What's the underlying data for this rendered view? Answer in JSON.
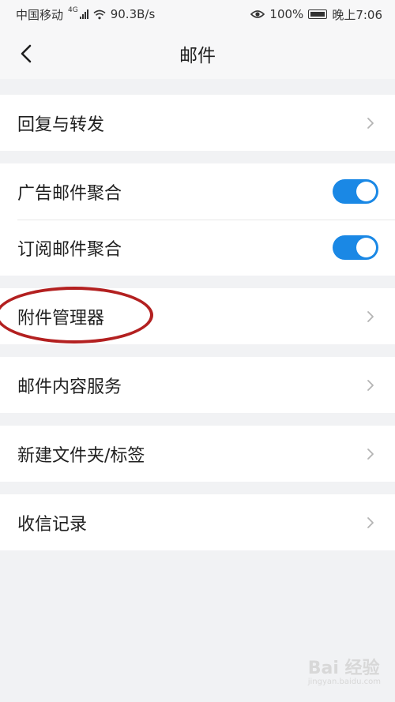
{
  "status_bar": {
    "carrier": "中国移动",
    "network": "4G",
    "speed": "90.3B/s",
    "battery": "100%",
    "time": "晚上7:06"
  },
  "header": {
    "title": "邮件",
    "back_icon": "chevron-left-icon"
  },
  "settings": {
    "reply_forward": "回复与转发",
    "ad_mail_aggregate": {
      "label": "广告邮件聚合",
      "enabled": true
    },
    "subscription_aggregate": {
      "label": "订阅邮件聚合",
      "enabled": true
    },
    "attachment_manager": "附件管理器",
    "content_service": "邮件内容服务",
    "new_folder_tag": "新建文件夹/标签",
    "receive_log": "收信记录"
  },
  "watermark": {
    "brand": "Bai 经验",
    "url": "jingyan.baidu.com"
  },
  "colors": {
    "accent": "#1a88e5",
    "annotation": "#b32020",
    "background": "#f1f2f4"
  }
}
